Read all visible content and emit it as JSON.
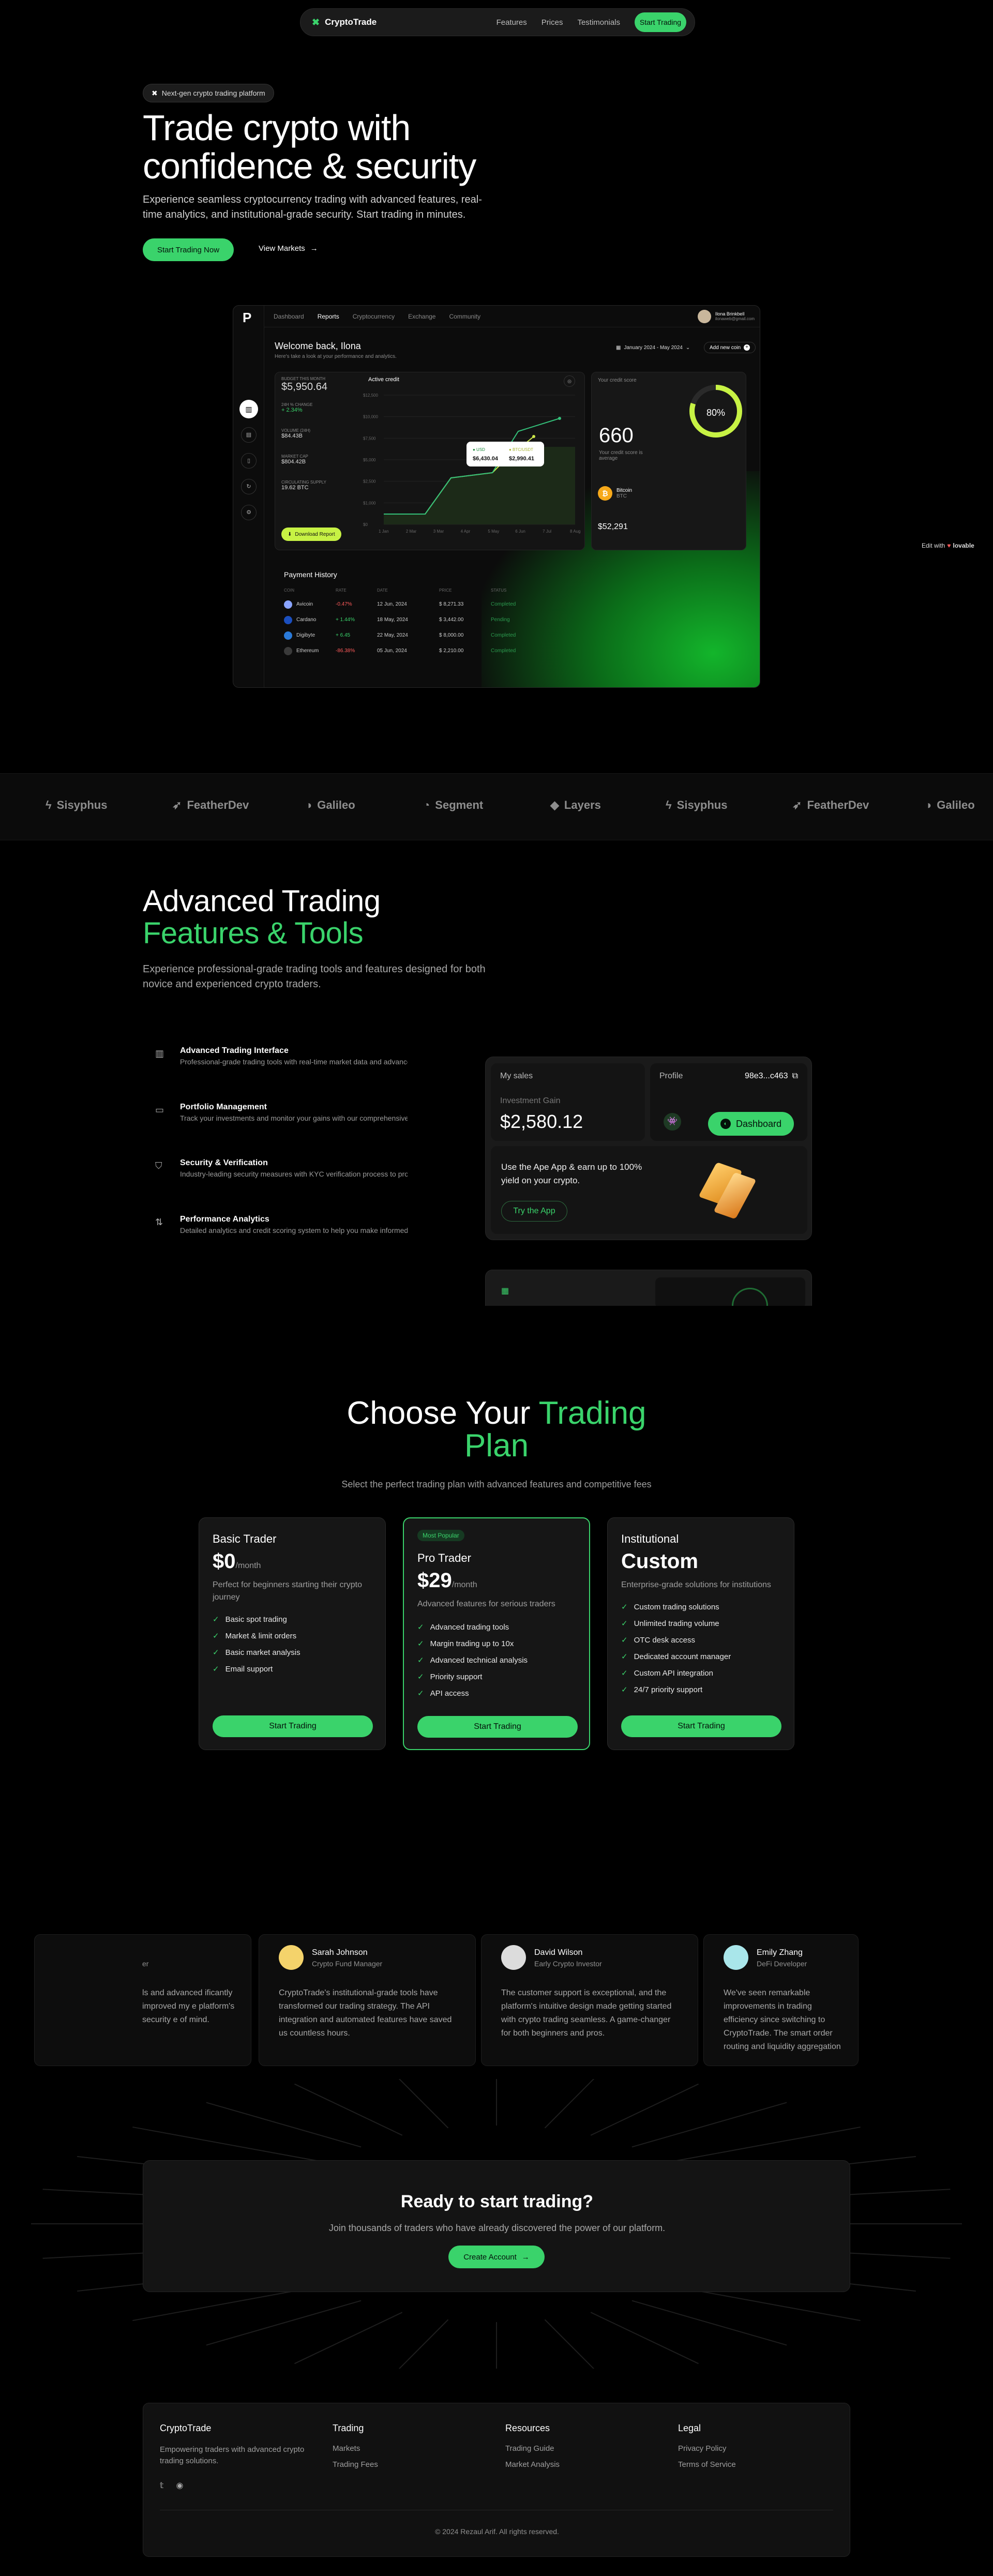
{
  "nav": {
    "brand": "CryptoTrade",
    "links": [
      "Features",
      "Prices",
      "Testimonials"
    ],
    "cta": "Start Trading"
  },
  "hero": {
    "badge": "Next-gen crypto trading platform",
    "title_line1": "Trade crypto with",
    "title_line2": "confidence & security",
    "subtitle": "Experience seamless cryptocurrency trading with advanced features, real-time analytics, and institutional-grade security. Start trading in minutes.",
    "primary_cta": "Start Trading Now",
    "secondary_cta": "View Markets"
  },
  "dashboard": {
    "logo": "P",
    "tabs": [
      "Dashboard",
      "Reports",
      "Cryptocurrency",
      "Exchange",
      "Community"
    ],
    "active_tab": "Reports",
    "user_name": "Ilona Brinkbell",
    "user_email": "ilonaweb@gmail.com",
    "welcome": "Welcome back, Ilona",
    "welcome_sub": "Here's take a look at your performance and analytics.",
    "date_range": "January 2024 - May 2024",
    "add_widget": "Add new coin",
    "stats": [
      {
        "label": "BUDGET THIS MONTH",
        "value": "$5,950.64"
      },
      {
        "label": "24H % CHANGE",
        "value": "+ 2.34%"
      },
      {
        "label": "VOLUME (24H)",
        "value": "$84.43B"
      },
      {
        "label": "MARKET CAP",
        "value": "$804.42B"
      },
      {
        "label": "CIRCULATING SUPPLY",
        "value": "19.62 BTC"
      }
    ],
    "download": "Download Report",
    "chart_title": "Active credit",
    "y_ticks": [
      "$12,500",
      "$10,000",
      "$7,500",
      "$5,000",
      "$2,500",
      "$1,000",
      "$0"
    ],
    "x_ticks": [
      "1 Jan",
      "2 Mar",
      "3 Mar",
      "4 Apr",
      "5 May",
      "6 Jun",
      "7 Jul",
      "8 Aug"
    ],
    "tooltip": {
      "a_label": "USD",
      "a_value": "$6,430.04",
      "b_label": "BTC/USDT",
      "b_value": "$2,990.41"
    },
    "credit_title": "Your credit score",
    "credit_value": "660",
    "credit_note": "Your credit score is average",
    "credit_pct": "80%",
    "credit_fill": 0.8,
    "coin_name": "Bitcoin",
    "coin_sym": "BTC",
    "coin_value": "$52,291",
    "history_title": "Payment History",
    "history_headers": [
      "COIN",
      "RATE",
      "DATE",
      "PRICE",
      "STATUS"
    ],
    "history": [
      {
        "coin": "Avicoin",
        "rate": "-0.47%",
        "date": "12 Jun, 2024",
        "price": "$ 8,271.33",
        "status": "Completed"
      },
      {
        "coin": "Cardano",
        "rate": "+ 1.44%",
        "date": "18 May, 2024",
        "price": "$ 3,442.00",
        "status": "Pending"
      },
      {
        "coin": "Digibyte",
        "rate": "+ 6.45",
        "date": "22 May, 2024",
        "price": "$ 8,000.00",
        "status": "Completed"
      },
      {
        "coin": "Ethereum",
        "rate": "-86.38%",
        "date": "05 Jun, 2024",
        "price": "$ 2,210.00",
        "status": "Completed"
      }
    ]
  },
  "edit_with": "Edit with",
  "edit_brand": "lovable",
  "logos": [
    "Sisyphus",
    "FeatherDev",
    "Galileo",
    "Segment",
    "Layers",
    "Sisyphus",
    "FeatherDev",
    "Galileo"
  ],
  "features": {
    "title_line1": "Advanced Trading",
    "title_line2": "Features & Tools",
    "subtitle": "Experience professional-grade trading tools and features designed for both novice and experienced crypto traders.",
    "items": [
      {
        "title": "Advanced Trading Interface",
        "desc": "Professional-grade trading tools with real-time market data and advanced charting"
      },
      {
        "title": "Portfolio Management",
        "desc": "Track your investments and monitor your gains with our comprehensive tools"
      },
      {
        "title": "Security & Verification",
        "desc": "Industry-leading security measures with KYC verification process to protect"
      },
      {
        "title": "Performance Analytics",
        "desc": "Detailed analytics and credit scoring system to help you make informed decisions"
      }
    ],
    "panel": {
      "sales_label": "My sales",
      "gain_label": "Investment Gain",
      "gain_value": "$2,580.12",
      "profile_label": "Profile",
      "wallet": "98e3...c463",
      "dashboard_btn": "Dashboard",
      "promo": "Use the Ape App & earn up to 100% yield on your crypto.",
      "try_btn": "Try the App"
    }
  },
  "pricing": {
    "title_a": "Choose Your",
    "title_b": "Trading",
    "title_c": "Plan",
    "subtitle": "Select the perfect trading plan with advanced features and competitive fees",
    "plans": [
      {
        "name": "Basic Trader",
        "price": "$0",
        "period": "/month",
        "desc": "Perfect for beginners starting their crypto journey",
        "features": [
          "Basic spot trading",
          "Market & limit orders",
          "Basic market analysis",
          "Email support"
        ],
        "cta": "Start Trading"
      },
      {
        "name": "Pro Trader",
        "badge": "Most Popular",
        "price": "$29",
        "period": "/month",
        "desc": "Advanced features for serious traders",
        "features": [
          "Advanced trading tools",
          "Margin trading up to 10x",
          "Advanced technical analysis",
          "Priority support",
          "API access"
        ],
        "cta": "Start Trading"
      },
      {
        "name": "Institutional",
        "price": "Custom",
        "period": "",
        "desc": "Enterprise-grade solutions for institutions",
        "features": [
          "Custom trading solutions",
          "Unlimited trading volume",
          "OTC desk access",
          "Dedicated account manager",
          "Custom API integration",
          "24/7 priority support"
        ],
        "cta": "Start Trading"
      }
    ]
  },
  "testimonials": [
    {
      "name": "",
      "role": "er",
      "quote": "ls and advanced ificantly improved my e platform's security e of mind."
    },
    {
      "name": "Sarah Johnson",
      "role": "Crypto Fund Manager",
      "quote": "CryptoTrade's institutional-grade tools have transformed our trading strategy. The API integration and automated features have saved us countless hours."
    },
    {
      "name": "David Wilson",
      "role": "Early Crypto Investor",
      "quote": "The customer support is exceptional, and the platform's intuitive design made getting started with crypto trading seamless. A game-changer for both beginners and pros."
    },
    {
      "name": "Emily Zhang",
      "role": "DeFi Developer",
      "quote": "We've seen remarkable improvements in trading efficiency since switching to CryptoTrade. The smart order routing and liquidity aggregation are particularly impressive."
    }
  ],
  "cta": {
    "title": "Ready to start trading?",
    "subtitle": "Join thousands of traders who have already discovered the power of our platform.",
    "button": "Create Account"
  },
  "footer": {
    "brand": "CryptoTrade",
    "tagline": "Empowering traders with advanced crypto trading solutions.",
    "cols": [
      {
        "title": "Trading",
        "links": [
          "Markets",
          "Trading Fees"
        ]
      },
      {
        "title": "Resources",
        "links": [
          "Trading Guide",
          "Market Analysis"
        ]
      },
      {
        "title": "Legal",
        "links": [
          "Privacy Policy",
          "Terms of Service"
        ]
      }
    ],
    "copyright": "© 2024 Rezaul Arif. All rights reserved."
  }
}
